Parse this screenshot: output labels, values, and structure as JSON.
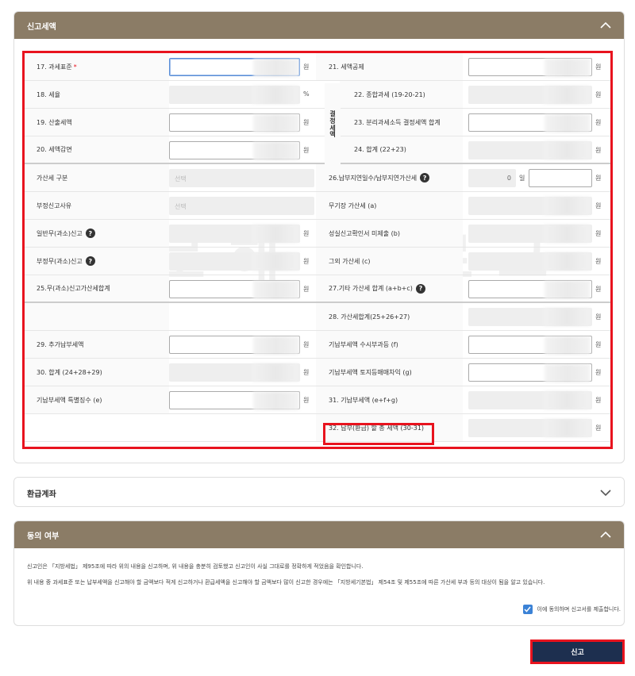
{
  "sections": {
    "tax_section_title": "신고세액",
    "refund_title": "환급계좌",
    "consent_title": "동의 여부"
  },
  "unit": "원",
  "percent_unit": "%",
  "day_unit": "일",
  "select_placeholder": "선택",
  "side_label": "결\n정\n세\n액",
  "left_rows": [
    {
      "label": "17. 과세표준",
      "required": "*"
    },
    {
      "label": "18. 세율"
    },
    {
      "label": "19. 산출세액"
    },
    {
      "label": "20. 세액감면"
    },
    {
      "label": "가산세 구분"
    },
    {
      "label": "부정신고사유"
    },
    {
      "label": "일반무(과소)신고"
    },
    {
      "label": "부정무(과소)신고"
    },
    {
      "label": "25.무(과소)신고가산세합계"
    },
    {
      "label": ""
    },
    {
      "label": "29. 추가납부세액"
    },
    {
      "label": "30. 합계 (24+28+29)"
    },
    {
      "label": "기납부세액 특별징수 (e)"
    }
  ],
  "right_rows": [
    {
      "label": "21. 세액공제"
    },
    {
      "label": "22. 종합과세 (19-20-21)"
    },
    {
      "label": "23. 분리과세소득 결정세액 합계"
    },
    {
      "label": "24. 합계 (22+23)"
    },
    {
      "label": "26.납부지연일수/납부지연가산세"
    },
    {
      "label": "무기장 가산세 (a)"
    },
    {
      "label": "성실신고확인서 미제출 (b)"
    },
    {
      "label": "그외 가산세 (c)"
    },
    {
      "label": "27.기타 가산세 합계 (a+b+c)"
    },
    {
      "label": "28. 가산세합계(25+26+27)"
    },
    {
      "label": "기납부세액 수시부과등 (f)"
    },
    {
      "label": "기납부세액 토지등매매차익 (g)"
    },
    {
      "label": "31. 기납부세액 (e+f+g)"
    },
    {
      "label": "32. 납부(환급) 할 총 세액 (30-31)"
    }
  ],
  "delay_days": "0",
  "consent": {
    "line1": "신고인은 「지방세법」 제95조에 따라 위의 내용을 신고하며, 위 내용을 충분히 검토했고 신고인이 사실 그대로를 정확하게 적었음을 확인합니다.",
    "line2": "위 내용 중 과세표준 또는 납부세액을 신고해야 할 금액보다 적게 신고하거나 환급세액을 신고해야 할 금액보다 많이 신고한 경우에는 「지방세기본법」 제54조 및 제55조에 따른 가산세 부과 등의 대상이 됨을 알고 있습니다.",
    "checkbox_label": "이에 동의하며 신고서를 제출합니다.",
    "checked": true
  },
  "submit_label": "신고",
  "watermark": "나로해 블로그",
  "colors": {
    "header": "#8b7c66",
    "accent_red": "#e8131e",
    "submit": "#1d2f4f",
    "check": "#3b82d6"
  }
}
